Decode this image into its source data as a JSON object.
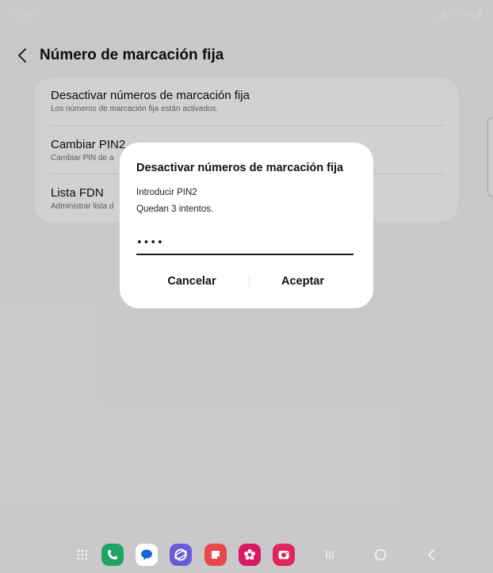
{
  "status_bar": {
    "time": "10:00",
    "battery": "100%"
  },
  "header": {
    "title": "Número de marcación fija"
  },
  "settings": {
    "items": [
      {
        "title": "Desactivar números de marcación fija",
        "subtitle": "Los números de marcación fija están activados."
      },
      {
        "title": "Cambiar PIN2",
        "subtitle": "Cambiar PIN de a"
      },
      {
        "title": "Lista FDN",
        "subtitle": "Administrar lista d"
      }
    ]
  },
  "dialog": {
    "title": "Desactivar números de marcación fija",
    "line1": "Introducir PIN2",
    "line2": "Quedan 3 intentos.",
    "pin_value": "••••",
    "cancel_label": "Cancelar",
    "accept_label": "Aceptar"
  },
  "dock": {
    "apps": [
      {
        "name": "phone-app",
        "color": "#1fa463"
      },
      {
        "name": "messages-app",
        "color": "#ffffff"
      },
      {
        "name": "internet-app",
        "color": "#6a5cd8"
      },
      {
        "name": "notes-app",
        "color": "#e8474b"
      },
      {
        "name": "gallery-app",
        "color": "#d81b60"
      },
      {
        "name": "camera-app",
        "color": "#e0245e"
      }
    ]
  },
  "colors": {
    "overlay": "rgba(0,0,0,0.18)",
    "card": "#ffffff",
    "background": "#f6f6f8"
  }
}
